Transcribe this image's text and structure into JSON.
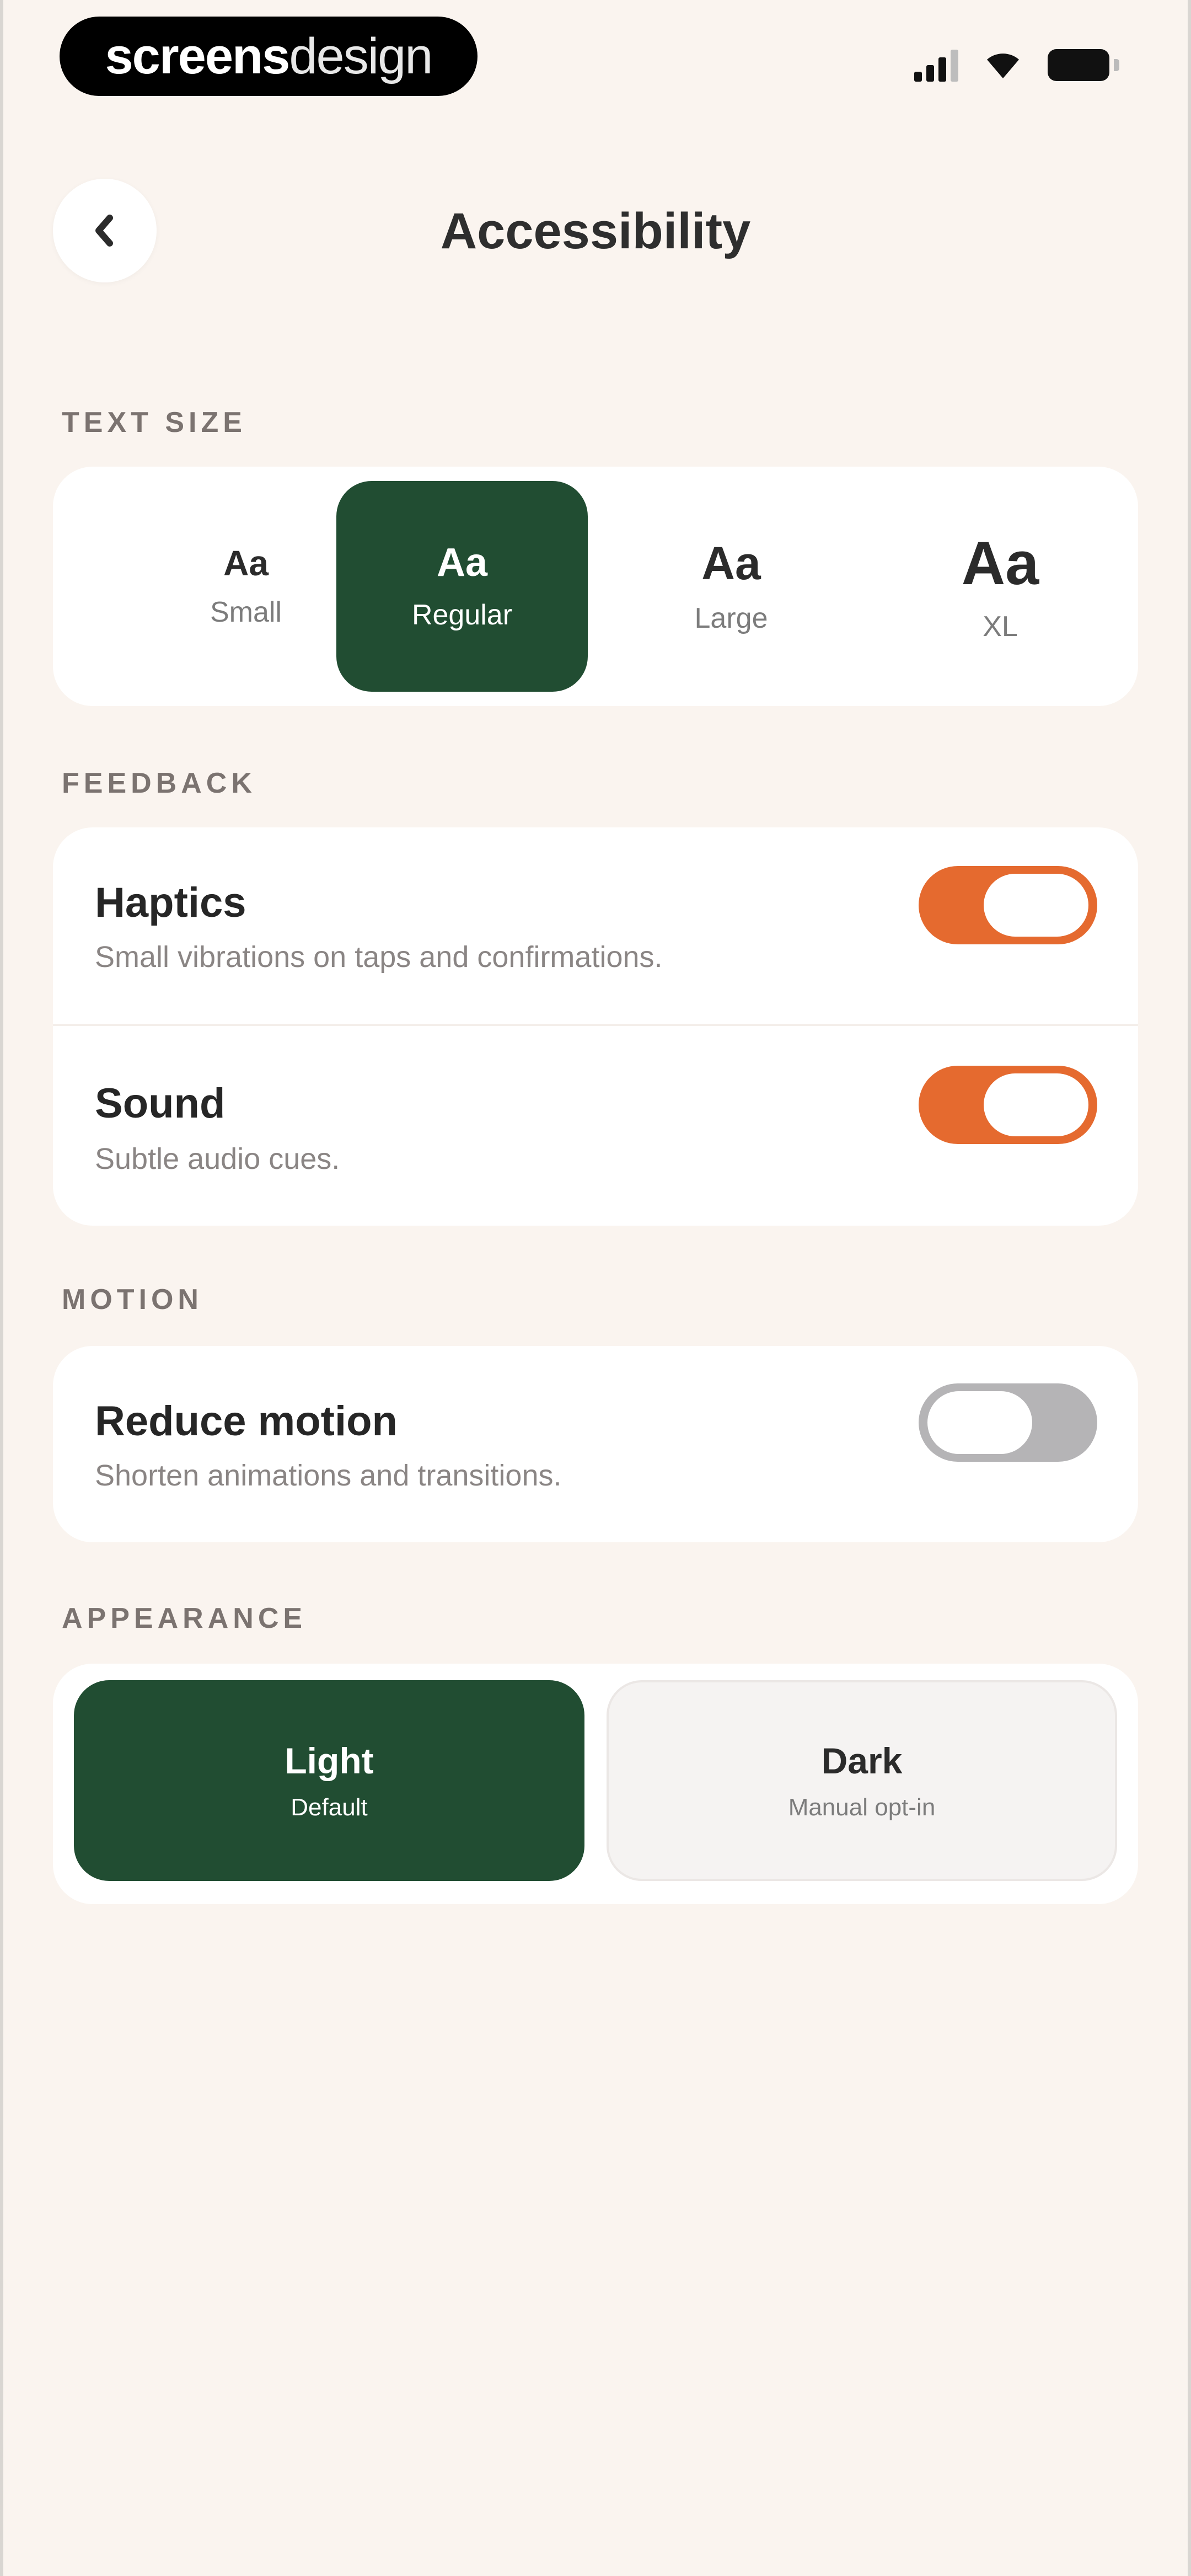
{
  "status_bar": {
    "brand_bold": "screens",
    "brand_light": "design"
  },
  "header": {
    "title": "Accessibility"
  },
  "text_size": {
    "section_label": "TEXT SIZE",
    "options": [
      {
        "sample": "Aa",
        "name": "Small"
      },
      {
        "sample": "Aa",
        "name": "Regular"
      },
      {
        "sample": "Aa",
        "name": "Large"
      },
      {
        "sample": "Aa",
        "name": "XL"
      }
    ],
    "selected": "Regular"
  },
  "feedback": {
    "section_label": "FEEDBACK",
    "haptics": {
      "title": "Haptics",
      "subtitle": "Small vibrations on taps and confirmations.",
      "enabled": true
    },
    "sound": {
      "title": "Sound",
      "subtitle": "Subtle audio cues.",
      "enabled": true
    }
  },
  "motion": {
    "section_label": "MOTION",
    "reduce_motion": {
      "title": "Reduce motion",
      "subtitle": "Shorten animations and transitions.",
      "enabled": false
    }
  },
  "appearance": {
    "section_label": "APPEARANCE",
    "options": [
      {
        "name": "Light",
        "subtitle": "Default"
      },
      {
        "name": "Dark",
        "subtitle": "Manual opt-in"
      }
    ],
    "selected": "Light"
  },
  "colors": {
    "background": "#faf4ef",
    "accent_green": "#214d32",
    "toggle_on": "#e56a2f",
    "toggle_off": "#b5b4b6"
  }
}
